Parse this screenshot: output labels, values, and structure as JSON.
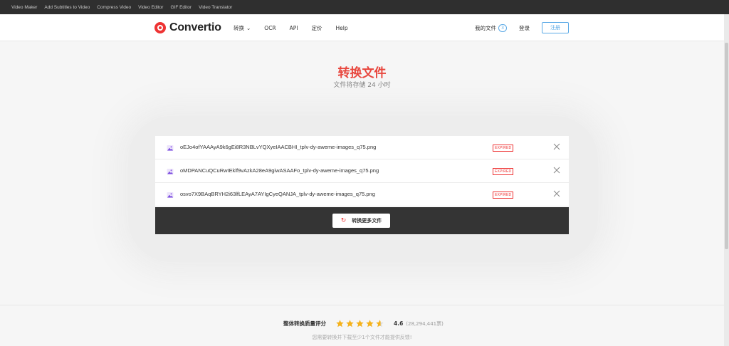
{
  "topbar": {
    "links": [
      "Video Maker",
      "Add Subtitles to Video",
      "Compress Video",
      "Video Editor",
      "GIF Editor",
      "Video Translator"
    ]
  },
  "nav": {
    "logo_text": "Convertio",
    "menu": [
      "转换",
      "OCR",
      "API",
      "定价",
      "Help"
    ],
    "my_files_label": "我的文件",
    "my_files_count": "3",
    "login_label": "登录",
    "signup_label": "注册"
  },
  "main": {
    "title": "转换文件",
    "subtitle": "文件将存储 24 小时"
  },
  "files": [
    {
      "name": "oEJo4ofYAAAyA9k6gEi8R3NBLvYQXyeIAACBHI_tplv-dy-aweme-images_q75.png",
      "status": "EXPIRED"
    },
    {
      "name": "oMDPANCuQCuRwIEklf9vAzkA28eA9giwASAAFo_tplv-dy-aweme-images_q75.png",
      "status": "EXPIRED"
    },
    {
      "name": "osvo7X9BAqBRYH2i63lfLEAyA7AYIgCyeQANJA_tplv-dy-aweme-images_q75.png",
      "status": "EXPIRED"
    }
  ],
  "actions": {
    "convert_more_label": "转换更多文件"
  },
  "footer": {
    "rating_label": "整体转换质量评分",
    "score": "4.6",
    "votes": "(28,294,441票)",
    "rating_value": 4.6,
    "rating_max": 5,
    "note": "您需要转换并下载至少1个文件才能提供反馈!"
  },
  "colors": {
    "brand_red": "#e8453c",
    "accent_blue": "#5aa9e6",
    "star_gold": "#f5b21b"
  }
}
